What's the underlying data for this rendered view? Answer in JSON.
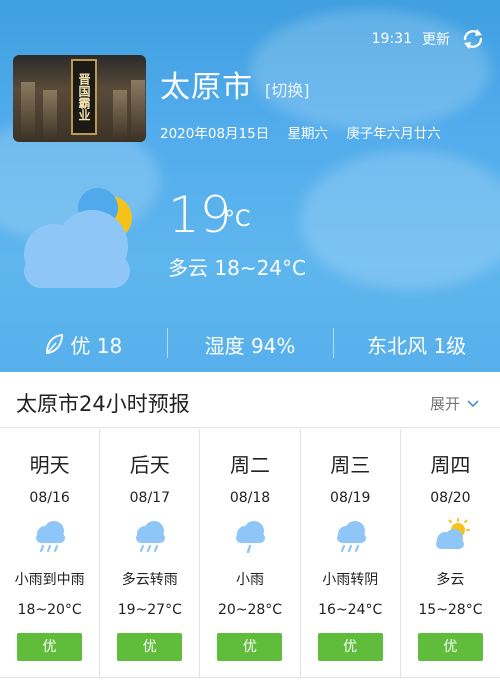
{
  "status": {
    "time": "19:31",
    "update_label": "更新"
  },
  "location": {
    "city": "太原市",
    "switch_label": "[切换]",
    "date": "2020年08月15日",
    "weekday": "星期六",
    "lunar": "庚子年六月廿六",
    "banner_text": "晋国霸业"
  },
  "current": {
    "temperature": "19",
    "unit": "°C",
    "condition": "多云 18~24°C",
    "icon": "cloudy-night-icon"
  },
  "stats": {
    "aqi": "优 18",
    "humidity": "湿度 94%",
    "wind": "东北风 1级"
  },
  "forecast_section": {
    "title": "太原市24小时预报",
    "expand_label": "展开"
  },
  "forecast": [
    {
      "day": "明天",
      "date": "08/16",
      "desc": "小雨到中雨",
      "range": "18~20°C",
      "aqi": "优",
      "icon": "rain-icon"
    },
    {
      "day": "后天",
      "date": "08/17",
      "desc": "多云转雨",
      "range": "19~27°C",
      "aqi": "优",
      "icon": "rain-icon"
    },
    {
      "day": "周二",
      "date": "08/18",
      "desc": "小雨",
      "range": "20~28°C",
      "aqi": "优",
      "icon": "light-rain-icon"
    },
    {
      "day": "周三",
      "date": "08/19",
      "desc": "小雨转阴",
      "range": "16~24°C",
      "aqi": "优",
      "icon": "rain-icon"
    },
    {
      "day": "周四",
      "date": "08/20",
      "desc": "多云",
      "range": "15~28°C",
      "aqi": "优",
      "icon": "partly-cloudy-icon"
    }
  ],
  "colors": {
    "sky": "#4fa9ea",
    "aqi_good": "#5fbd3b",
    "icon_cloud": "#7fbff5",
    "moon": "#f5c21a"
  }
}
